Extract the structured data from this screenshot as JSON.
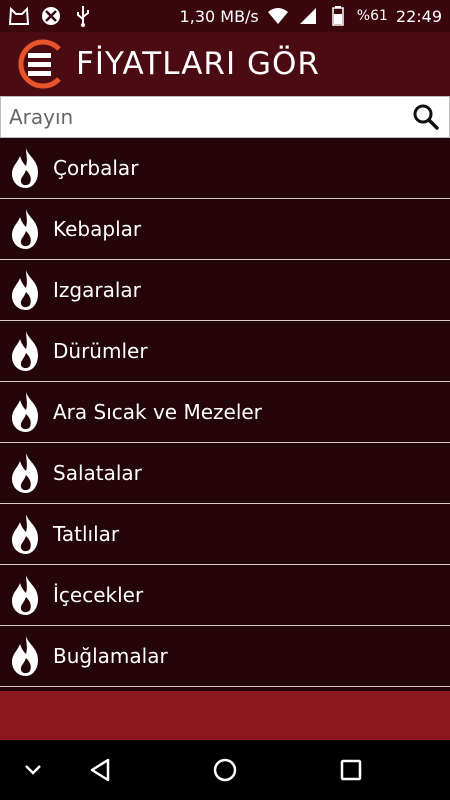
{
  "status_bar": {
    "network_speed": "1,30 MB/s",
    "battery": "%61",
    "time": "22:49",
    "icons": [
      "cat-face-icon",
      "no-entry-icon",
      "usb-icon",
      "wifi-icon",
      "signal-icon",
      "battery-icon"
    ]
  },
  "app_bar": {
    "title": "FİYATLARI GÖR",
    "logo": "menu-logo-icon"
  },
  "search": {
    "placeholder": "Arayın",
    "value": ""
  },
  "menu": {
    "icon": "flame-icon",
    "items": [
      {
        "label": "Çorbalar"
      },
      {
        "label": "Kebaplar"
      },
      {
        "label": "Izgaralar"
      },
      {
        "label": "Dürümler"
      },
      {
        "label": "Ara Sıcak ve Mezeler"
      },
      {
        "label": "Salatalar"
      },
      {
        "label": "Tatlılar"
      },
      {
        "label": "İçecekler"
      },
      {
        "label": "Buğlamalar"
      }
    ]
  },
  "nav_bar": {
    "buttons": [
      "down-chevron-icon",
      "back-icon",
      "home-icon",
      "recents-icon"
    ]
  },
  "colors": {
    "app_bar": "#4a0b12",
    "list_bg": "#23050a",
    "accent": "#e8542a",
    "band": "#8b1720"
  }
}
